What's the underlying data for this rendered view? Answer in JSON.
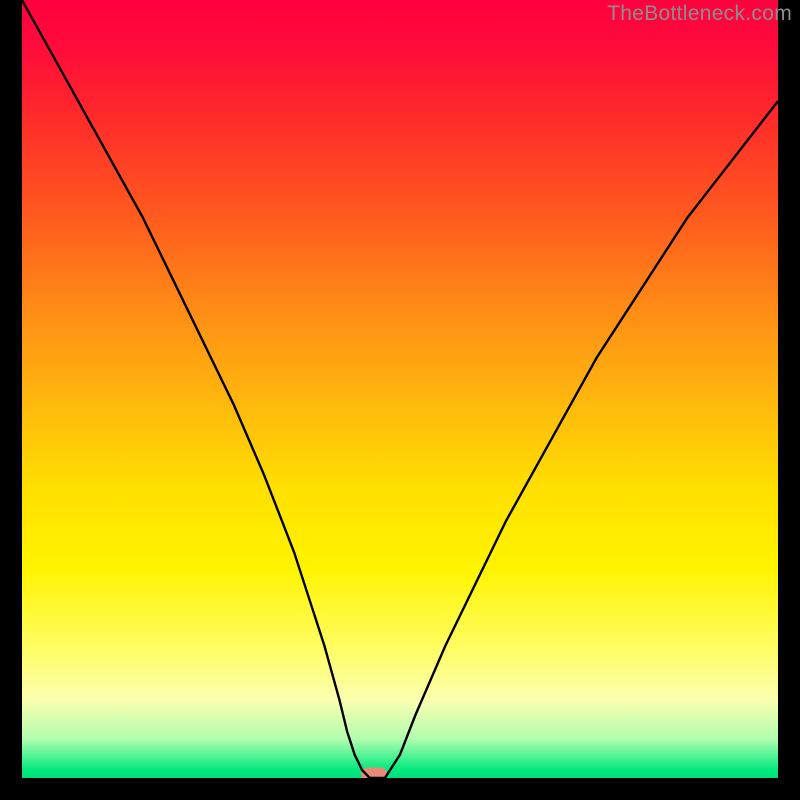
{
  "watermark": "TheBottleneck.com",
  "chart_data": {
    "type": "line",
    "title": "",
    "xlabel": "",
    "ylabel": "",
    "xlim": [
      0,
      100
    ],
    "ylim": [
      0,
      100
    ],
    "grid": false,
    "x": [
      0,
      4,
      8,
      12,
      16,
      20,
      24,
      28,
      32,
      34,
      36,
      38,
      40,
      42,
      43,
      44,
      45,
      46,
      47,
      48,
      50,
      52,
      56,
      60,
      64,
      68,
      72,
      76,
      80,
      84,
      88,
      92,
      96,
      100
    ],
    "values": [
      100,
      93,
      86,
      79,
      72,
      64,
      56,
      48,
      39,
      34,
      29,
      23,
      17,
      10,
      6,
      3,
      1,
      0,
      0,
      0,
      3,
      8,
      17,
      25,
      33,
      40,
      47,
      54,
      60,
      66,
      72,
      77,
      82,
      87
    ],
    "marker": {
      "x": 46.5,
      "y": 0.5
    },
    "background_gradient": {
      "type": "vertical",
      "stops": [
        {
          "pos": 0,
          "color": "#ff003e"
        },
        {
          "pos": 0.5,
          "color": "#ffd400"
        },
        {
          "pos": 0.85,
          "color": "#fff93a"
        },
        {
          "pos": 1.0,
          "color": "#00e07a"
        }
      ]
    }
  }
}
